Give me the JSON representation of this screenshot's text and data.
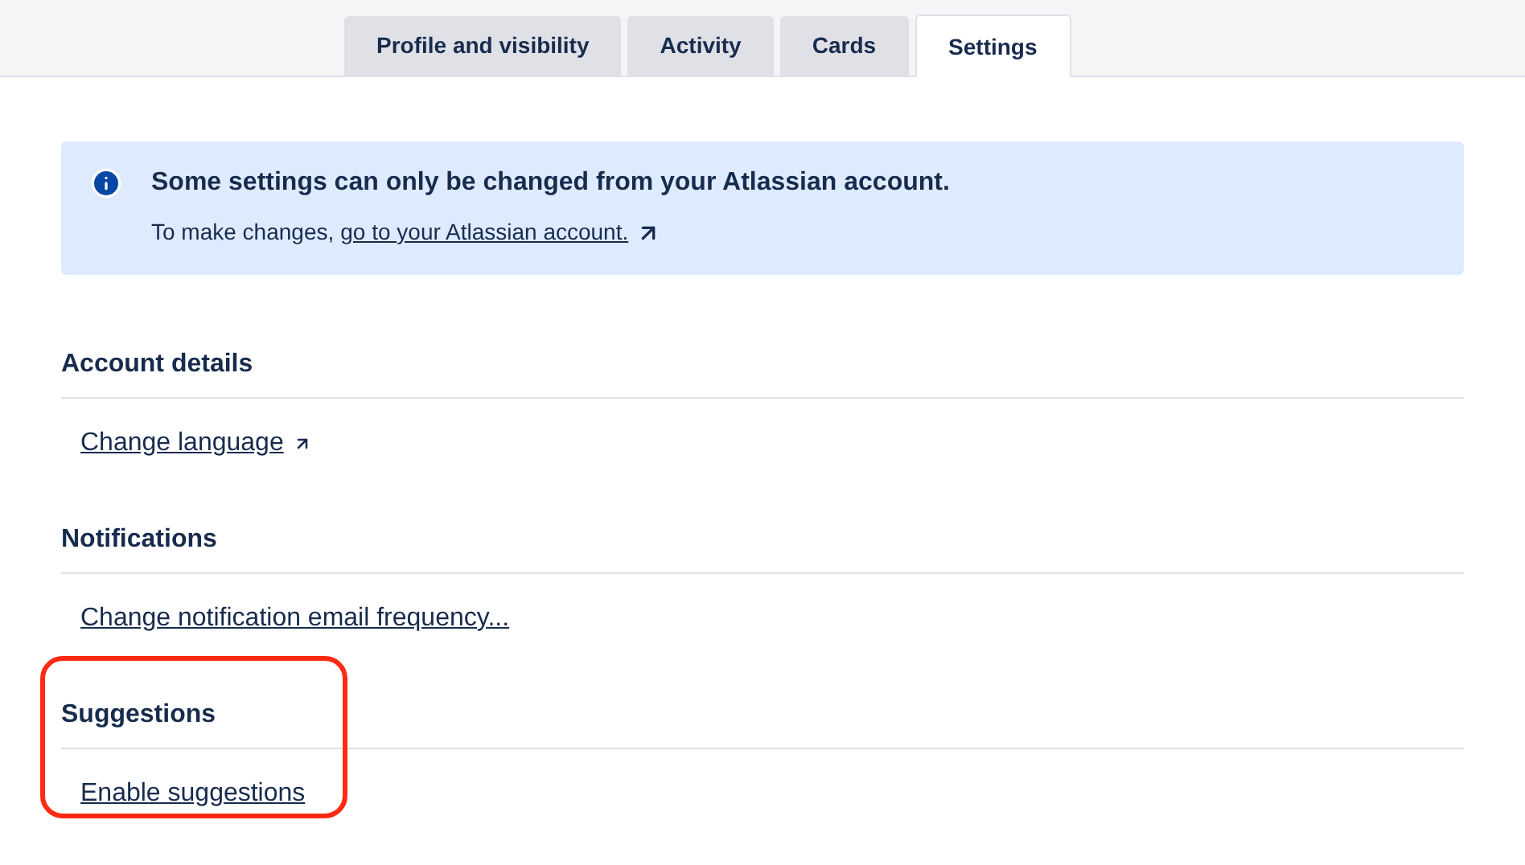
{
  "tabs": [
    {
      "label": "Profile and visibility",
      "selected": false
    },
    {
      "label": "Activity",
      "selected": false
    },
    {
      "label": "Cards",
      "selected": false
    },
    {
      "label": "Settings",
      "selected": true
    }
  ],
  "notice": {
    "title": "Some settings can only be changed from your Atlassian account.",
    "text": "To make changes,",
    "link": "go to your Atlassian account.",
    "external": true
  },
  "sections": [
    {
      "title": "Account details",
      "link": "Change language",
      "external": true,
      "highlighted": false
    },
    {
      "title": "Notifications",
      "link": "Change notification email frequency...",
      "external": false,
      "highlighted": false
    },
    {
      "title": "Suggestions",
      "link": "Enable suggestions",
      "external": false,
      "highlighted": true
    }
  ]
}
